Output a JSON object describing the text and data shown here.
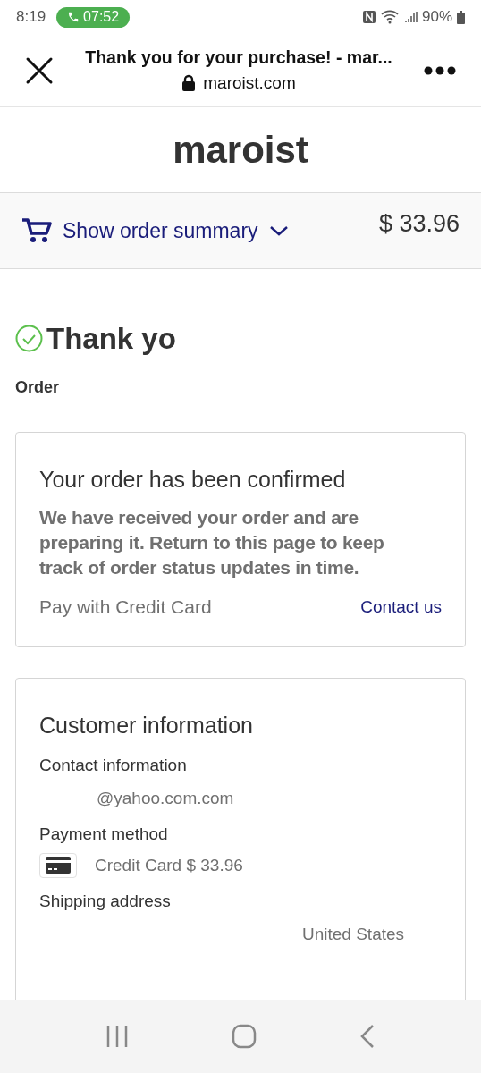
{
  "status_bar": {
    "time": "8:19",
    "call_timer": "07:52",
    "battery": "90%"
  },
  "browser_bar": {
    "title": "Thank you for your purchase! - mar...",
    "url": "maroist.com"
  },
  "store": {
    "name": "maroist"
  },
  "order_summary": {
    "label": "Show order summary",
    "expanded": false,
    "total": "$ 33.96"
  },
  "heading": "Thank yo",
  "order_label": "Order",
  "confirmation_card": {
    "title": "Your order has been confirmed",
    "message": "We have received your order and are preparing it. Return to this page to keep track of order status updates in time.",
    "payment_note": "Pay with Credit Card",
    "contact_link": "Contact us"
  },
  "customer_card": {
    "title": "Customer information",
    "sections": [
      {
        "kind": "text",
        "label": "Contact information",
        "value": "@yahoo.com.com"
      },
      {
        "kind": "payment",
        "label": "Payment method",
        "value": "Credit Card $ 33.96"
      },
      {
        "kind": "address",
        "label": "Shipping address",
        "value": "United States"
      }
    ]
  }
}
